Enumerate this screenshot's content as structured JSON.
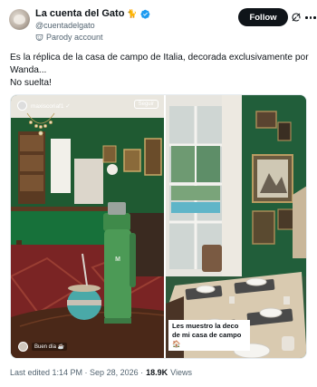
{
  "author": {
    "display_name": "La cuenta del Gato",
    "name_emoji": "🐈",
    "handle": "@cuentadelgato",
    "badge": "Parody account",
    "verified": true
  },
  "actions": {
    "follow_label": "Follow"
  },
  "tweet": {
    "lines": [
      "Es la réplica de la casa de campo de Italia, decorada exclusivamente por Wanda...",
      "No suelta!"
    ]
  },
  "media": {
    "left": {
      "username": "maxiscoriaf1 ✓",
      "follow_label": "Seguir",
      "caption": "Buen día ☕"
    },
    "right": {
      "caption": "Les muestro la deco de mi casa de campo 🏠"
    }
  },
  "meta": {
    "edited": "Last edited 1:14 PM · Sep 28, 2026 ·",
    "views_count": "18.9K",
    "views_label": "Views"
  },
  "colors": {
    "accent": "#1d9bf0",
    "text": "#0f1419",
    "muted": "#536471"
  }
}
